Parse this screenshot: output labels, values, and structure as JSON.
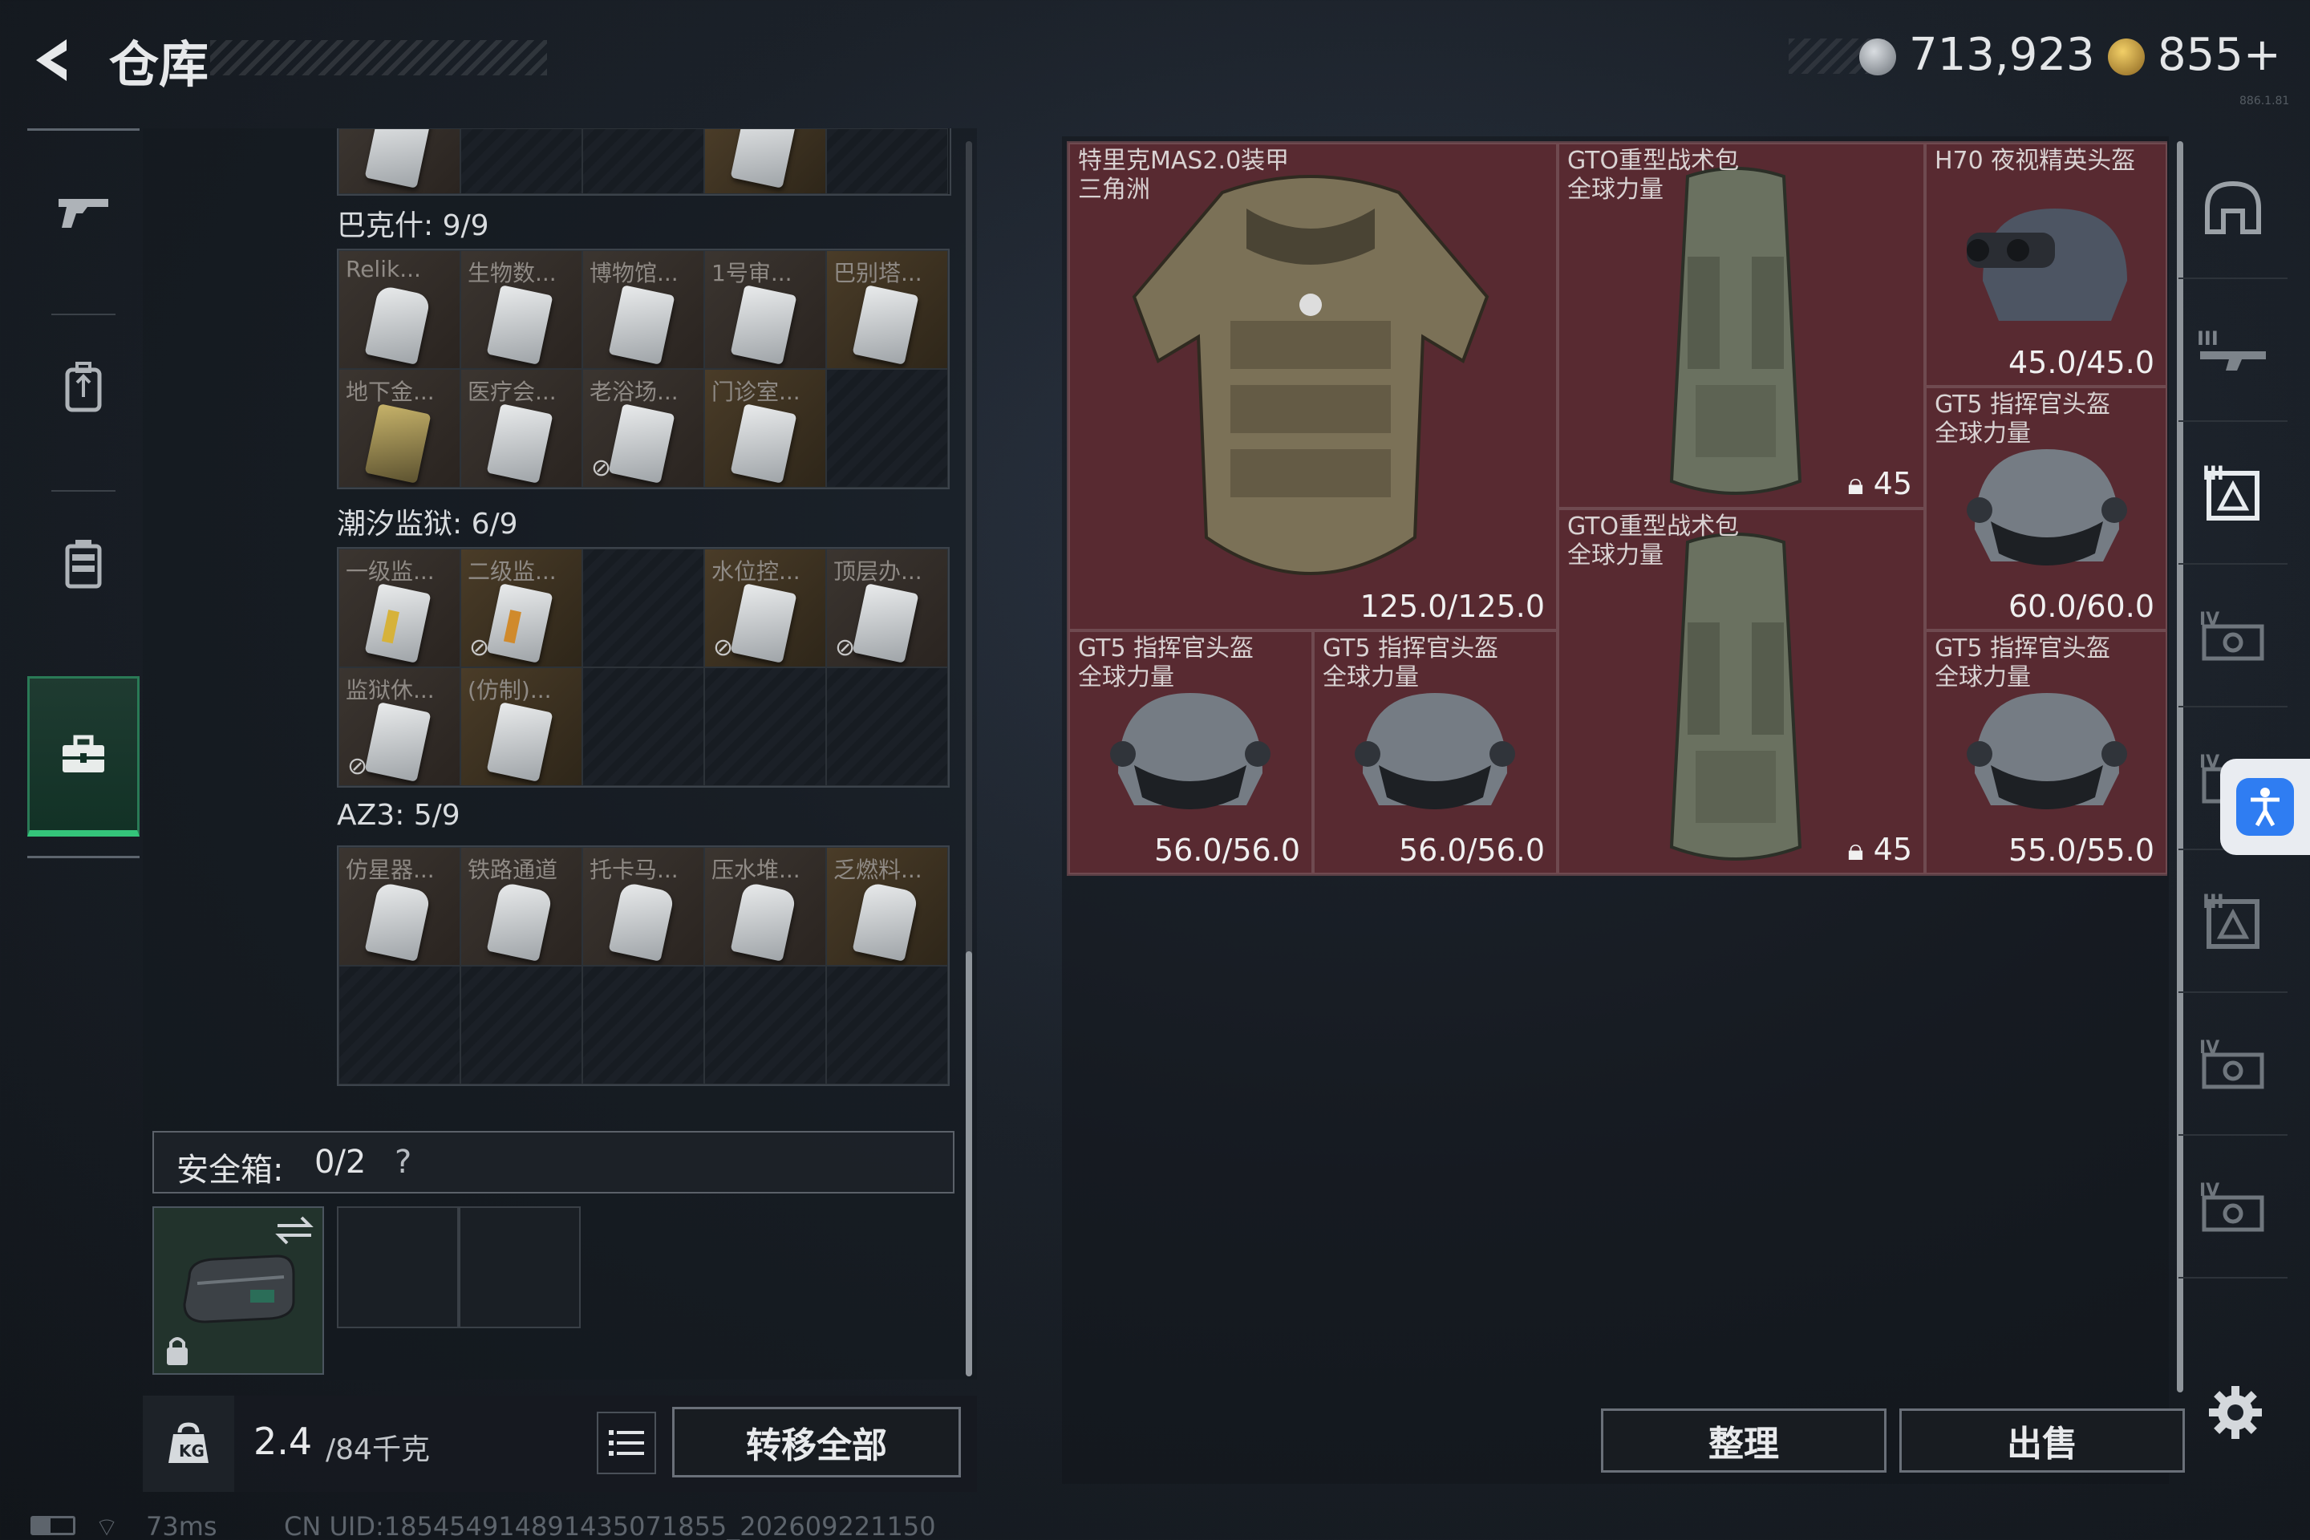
{
  "header": {
    "title": "仓库",
    "currency1": "713,923",
    "currency2": "855+",
    "version": "886.1.81"
  },
  "left_nav": {
    "items": [
      "weapons",
      "backpack",
      "chest-rig",
      "toolbox"
    ],
    "active": 3
  },
  "left_panel": {
    "sections": [
      {
        "title": "巴克什: 9/9",
        "labels": [
          "Relik...",
          "生物数...",
          "博物馆...",
          "1号审...",
          "巴别塔...",
          "地下金...",
          "医疗会...",
          "老浴场...",
          "门诊室..."
        ]
      },
      {
        "title": "潮汐监狱: 6/9",
        "labels": [
          "一级监...",
          "二级监...",
          "",
          "水位控...",
          "顶层办...",
          "监狱休...",
          "(仿制)...",
          "",
          ""
        ]
      },
      {
        "title": "AZ3: 5/9",
        "labels": [
          "仿星器...",
          "铁路通道",
          "托卡马...",
          "压水堆...",
          "乏燃料...",
          "",
          "",
          "",
          ""
        ]
      }
    ],
    "safe_box": {
      "label": "安全箱:",
      "count": "0/2",
      "help": "?"
    },
    "weight": {
      "value": "2.4",
      "max": "/84千克"
    },
    "transfer_all": "转移全部"
  },
  "stash_items": [
    {
      "name": "特里克MAS2.0装甲",
      "sub": "三角洲",
      "durability": "125.0/125.0",
      "kind": "armor"
    },
    {
      "name": "GTO重型战术包",
      "sub": "全球力量",
      "capacity": "45",
      "kind": "backpack"
    },
    {
      "name": "H70 夜视精英头盔",
      "sub": "",
      "durability": "45.0/45.0",
      "kind": "helmet-nv"
    },
    {
      "name": "GT5 指挥官头盔",
      "sub": "全球力量",
      "durability": "60.0/60.0",
      "kind": "helmet"
    },
    {
      "name": "GTO重型战术包",
      "sub": "全球力量",
      "capacity": "45",
      "kind": "backpack"
    },
    {
      "name": "GT5 指挥官头盔",
      "sub": "全球力量",
      "durability": "56.0/56.0",
      "kind": "helmet"
    },
    {
      "name": "GT5 指挥官头盔",
      "sub": "全球力量",
      "durability": "56.0/56.0",
      "kind": "helmet"
    },
    {
      "name": "GT5 指挥官头盔",
      "sub": "全球力量",
      "durability": "55.0/55.0",
      "kind": "helmet"
    }
  ],
  "actions": {
    "sort": "整理",
    "sell": "出售"
  },
  "right_nav": {
    "tiers": [
      "",
      "III",
      "III",
      "IV",
      "IV",
      "III",
      "IV",
      "IV",
      "IV"
    ]
  },
  "status_bar": {
    "ping": "73ms",
    "uid": "CN UID:1854549148914350718​55_202609221150"
  },
  "colors": {
    "accent_green": "#34c47a",
    "item_bg": "#5b2c33",
    "access_blue": "#2f7df2"
  }
}
